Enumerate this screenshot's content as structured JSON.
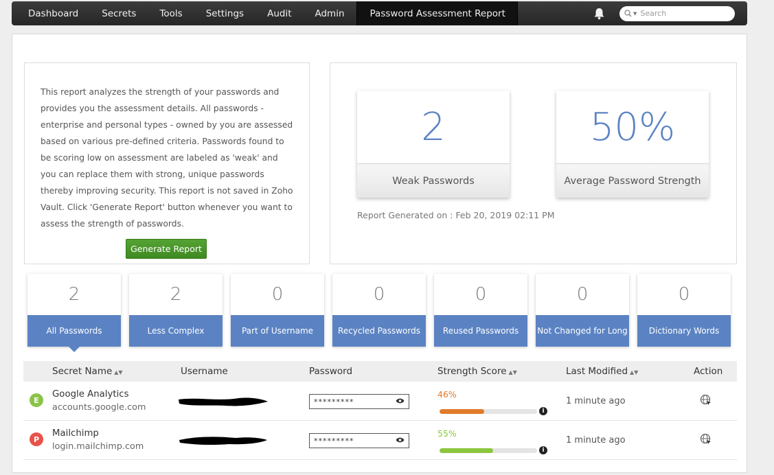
{
  "nav": {
    "items": [
      "Dashboard",
      "Secrets",
      "Tools",
      "Settings",
      "Audit",
      "Admin",
      "Password Assessment Report"
    ],
    "search_placeholder": "Search"
  },
  "description": {
    "text": "This report analyzes the strength of your passwords and provides you the assessment details. All passwords - enterprise and personal types - owned by you are assessed based on various pre-defined criteria. Passwords found to be scoring low on assessment are labeled as 'weak' and you can replace them with strong, unique passwords thereby improving security. This report is not saved in Zoho Vault. Click 'Generate Report' button whenever you want to assess the strength of passwords.",
    "button": "Generate Report"
  },
  "stats": {
    "weak": {
      "value": "2",
      "label": "Weak Passwords"
    },
    "average": {
      "value": "50%",
      "label": "Average Password Strength"
    },
    "report_date": "Report Generated on : Feb 20, 2019 02:11 PM"
  },
  "tiles": [
    {
      "value": "2",
      "label": "All Passwords"
    },
    {
      "value": "2",
      "label": "Less Complex"
    },
    {
      "value": "0",
      "label": "Part of Username"
    },
    {
      "value": "0",
      "label": "Recycled Passwords"
    },
    {
      "value": "0",
      "label": "Reused Passwords"
    },
    {
      "value": "0",
      "label": "Not Changed for Long"
    },
    {
      "value": "0",
      "label": "Dictionary Words"
    }
  ],
  "table": {
    "headers": [
      "Secret Name",
      "Username",
      "Password",
      "Strength Score",
      "Last Modified",
      "Action"
    ],
    "rows": [
      {
        "avatar": "E",
        "avatar_color": "#8bc34a",
        "name": "Google Analytics",
        "url": "accounts.google.com",
        "password": "*********",
        "score": "46%",
        "score_value": 0.46,
        "score_color": "#e07b2a",
        "last_modified": "1 minute ago"
      },
      {
        "avatar": "P",
        "avatar_color": "#e8534a",
        "name": "Mailchimp",
        "url": "login.mailchimp.com",
        "password": "*********",
        "score": "55%",
        "score_value": 0.55,
        "score_color": "#8cc63f",
        "last_modified": "1 minute ago"
      }
    ]
  },
  "colors": {
    "accent": "#5b83c3",
    "button_green": "#4a9a2b",
    "navbar": "#2f2f2f"
  }
}
